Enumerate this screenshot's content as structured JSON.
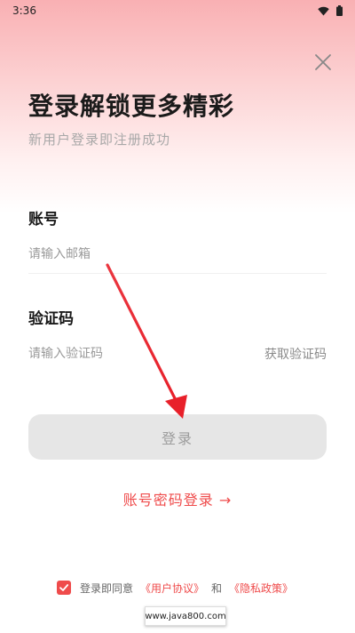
{
  "status_bar": {
    "time": "3:36"
  },
  "header": {
    "title": "登录解锁更多精彩",
    "subtitle": "新用户登录即注册成功"
  },
  "account": {
    "label": "账号",
    "placeholder": "请输入邮箱",
    "value": ""
  },
  "code": {
    "label": "验证码",
    "placeholder": "请输入验证码",
    "value": "",
    "get_code_label": "获取验证码"
  },
  "login_button": {
    "label": "登录"
  },
  "password_login": {
    "label": "账号密码登录 →"
  },
  "agreement": {
    "checked": true,
    "prefix": "登录即同意",
    "user_agreement": "《用户协议》",
    "and": "和",
    "privacy_policy": "《隐私政策》"
  },
  "watermark": {
    "text": "www.java800.com"
  },
  "colors": {
    "accent": "#ef4b4b",
    "annotation_arrow": "#e8202a",
    "button_disabled_bg": "#e6e6e6"
  }
}
